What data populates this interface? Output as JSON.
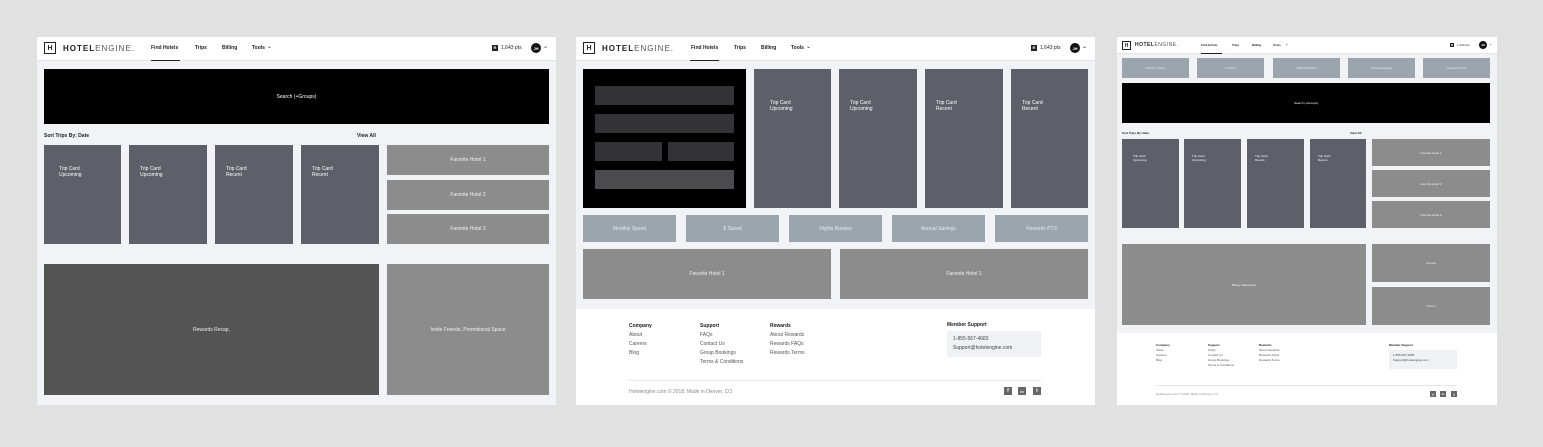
{
  "brand": {
    "box": "H",
    "text_bold": "HOTEL",
    "text_light": "ENGINE."
  },
  "nav": {
    "links": [
      "Find Hotels",
      "Trips",
      "Billing",
      "Tools"
    ],
    "points": "1,643 pts",
    "points_icon": "R",
    "avatar": "JH",
    "tools_chevron": "chevron-down-icon",
    "avatar_chevron": "chevron-down-icon"
  },
  "search": {
    "label": "Search (+Groups)"
  },
  "sort": {
    "label": "Sort Trips By: Date",
    "view_all": "View All"
  },
  "trip_cards": [
    "Trip Card\nUpcoming",
    "Trip Card\nUpcoming",
    "Trip Card\nRecent",
    "Trip Card\nRecent"
  ],
  "favorites": [
    "Favorite Hotel 1",
    "Favorite Hotel 2",
    "Favorite Hotel 3"
  ],
  "stats": [
    "Monthly Spend",
    "$ Saved",
    "Nights Booked",
    "Annual Savings",
    "Rewards PTS"
  ],
  "rewards_recap": "Rewards Recap,",
  "invite": "Invite Friends, Promotional Space",
  "billing": "Billing Statements",
  "groups": "Groups",
  "promo": "Promo",
  "footer": {
    "columns": [
      {
        "title": "Company",
        "items": [
          "About",
          "Careers",
          "Blog"
        ]
      },
      {
        "title": "Support",
        "items": [
          "FAQs",
          "Contact Us",
          "Group Bookings",
          "Terms & Conditions"
        ]
      },
      {
        "title": "Rewards",
        "items": [
          "About Rewards",
          "Rewards FAQs",
          "Rewards Terms"
        ]
      }
    ],
    "member_support": {
      "title": "Member Support",
      "phone": "1-855-567-4683",
      "email": "Support@hotelengine.com"
    },
    "copyright": "Hotelengine.com © 2018. Made in Denver, CO.",
    "social": [
      "facebook-icon",
      "linkedin-icon",
      "twitter-icon"
    ]
  },
  "colors": {
    "background": "#e1e1e1",
    "frame": "#f2f3f7",
    "black_block": "#000000",
    "trip_card": "#5d6068",
    "favorite": "#8c8c8c",
    "stat": "#9aa5ad",
    "dark_panel": "#545454"
  }
}
